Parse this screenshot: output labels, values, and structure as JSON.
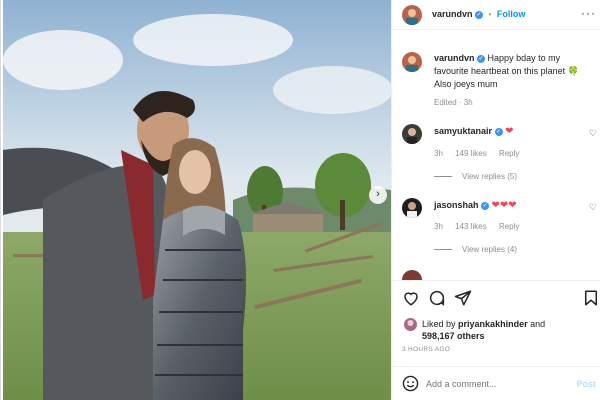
{
  "header": {
    "username": "varundvn",
    "follow_label": "Follow",
    "more_icon": "more-horizontal-icon"
  },
  "caption": {
    "username": "varundvn",
    "text": "Happy bday to my favourite heartbeat on this planet",
    "emoji": "🍀",
    "line2": "Also joeys mum",
    "edited": "Edited · 3h"
  },
  "comments": [
    {
      "username": "samyuktanair",
      "text": "❤",
      "age": "3h",
      "likes": "149 likes",
      "reply": "Reply",
      "view_replies": "View replies (5)"
    },
    {
      "username": "jasonshah",
      "text": "❤❤❤",
      "age": "3h",
      "likes": "143 likes",
      "reply": "Reply",
      "view_replies": "View replies (4)"
    }
  ],
  "likes": {
    "liked_by_prefix": "Liked by",
    "liked_by_user": "priyankakhinder",
    "and": "and",
    "others": "598,167 others"
  },
  "timestamp": "3 HOURS AGO",
  "add_comment": {
    "placeholder": "Add a comment...",
    "post_label": "Post"
  },
  "colors": {
    "accent": "#0095f6",
    "verified": "#3897f0",
    "heart": "#ed4956"
  }
}
